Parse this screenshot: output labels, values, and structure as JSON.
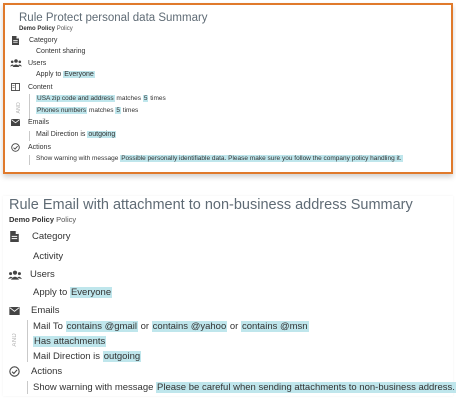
{
  "card1": {
    "title": "Rule Protect personal data Summary",
    "subtitle_bold": "Demo Policy",
    "subtitle_rest": "Policy",
    "category": {
      "label": "Category",
      "value": "Content sharing"
    },
    "users": {
      "label": "Users",
      "prefix": "Apply to",
      "value": "Everyone"
    },
    "content": {
      "label": "Content",
      "group_tag": "AND",
      "rows": [
        {
          "subject": "USA zip code and address",
          "verb": "matches",
          "count": "5",
          "suffix": "times"
        },
        {
          "subject": "Phones numbers",
          "verb": "matches",
          "count": "5",
          "suffix": "times"
        }
      ]
    },
    "emails": {
      "label": "Emails",
      "prefix": "Mail Direction is",
      "value": "outgoing"
    },
    "actions": {
      "label": "Actions",
      "prefix": "Show warning with message",
      "value": "Possible personally identifiable data. Please make sure you follow the company policy handling it."
    }
  },
  "card2": {
    "title": "Rule Email with attachment to non-business address Summary",
    "subtitle_bold": "Demo Policy",
    "subtitle_rest": "Policy",
    "category": {
      "label": "Category",
      "value": "Activity"
    },
    "users": {
      "label": "Users",
      "prefix": "Apply to",
      "value": "Everyone"
    },
    "emails": {
      "label": "Emails",
      "group_tag": "AND",
      "mail_to": {
        "prefix": "Mail To",
        "term1": "contains @gmail",
        "or1": "or",
        "term2": "contains @yahoo",
        "or2": "or",
        "term3": "contains @msn"
      },
      "attachments": "Has attachments",
      "direction_prefix": "Mail Direction is",
      "direction_value": "outgoing"
    },
    "actions": {
      "label": "Actions",
      "prefix": "Show warning with message",
      "value": "Please be careful when sending attachments to non-business address."
    }
  },
  "icons": {
    "category": "document-icon",
    "users": "users-icon",
    "content": "content-icon",
    "emails": "envelope-icon",
    "actions": "check-circle-icon"
  },
  "colors": {
    "highlight": "#bfe6ec",
    "selected_border": "#e07a2c",
    "title": "#5f6b75"
  }
}
